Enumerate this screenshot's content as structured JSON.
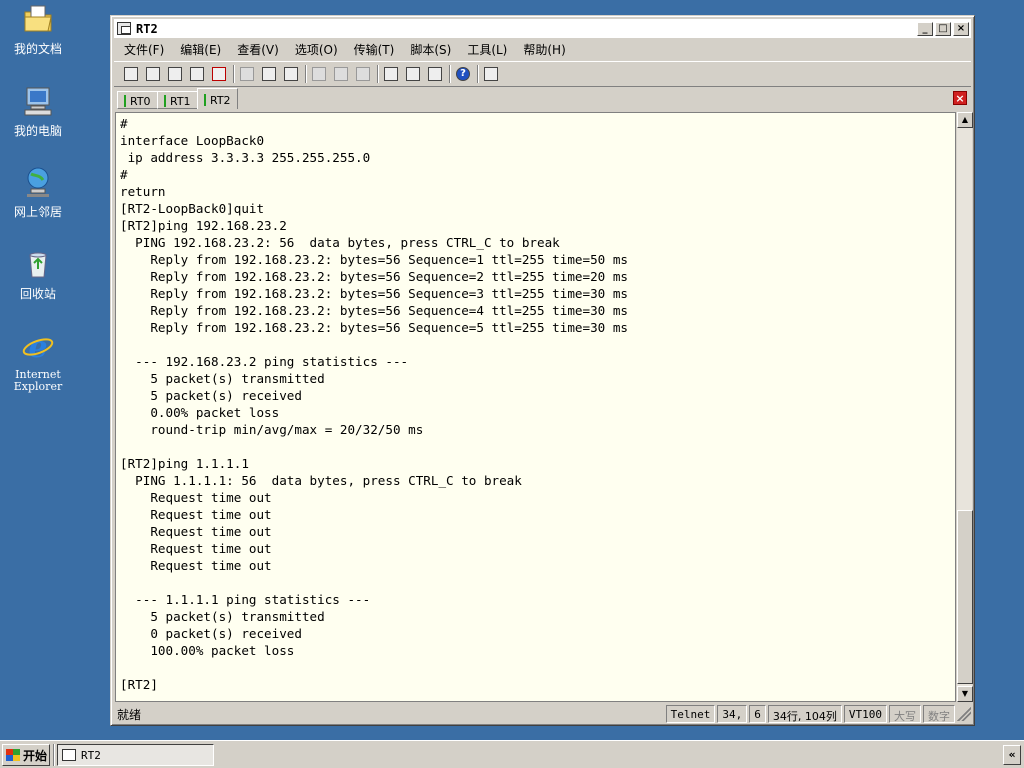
{
  "desktop": {
    "icons": [
      {
        "label": "我的文档",
        "icon": "folder-documents-icon"
      },
      {
        "label": "我的电脑",
        "icon": "computer-icon"
      },
      {
        "label": "网上邻居",
        "icon": "network-places-icon"
      },
      {
        "label": "回收站",
        "icon": "recycle-bin-icon"
      },
      {
        "label": "Internet\nExplorer",
        "icon": "internet-explorer-icon"
      }
    ]
  },
  "window": {
    "title": "RT2",
    "menu": [
      "文件(F)",
      "编辑(E)",
      "查看(V)",
      "选项(O)",
      "传输(T)",
      "脚本(S)",
      "工具(L)",
      "帮助(H)"
    ],
    "tabs": [
      "RT0",
      "RT1",
      "RT2"
    ],
    "active_tab": "RT2",
    "terminal_lines": [
      "#",
      "interface LoopBack0",
      " ip address 3.3.3.3 255.255.255.0",
      "#",
      "return",
      "[RT2-LoopBack0]quit",
      "[RT2]ping 192.168.23.2",
      "  PING 192.168.23.2: 56  data bytes, press CTRL_C to break",
      "    Reply from 192.168.23.2: bytes=56 Sequence=1 ttl=255 time=50 ms",
      "    Reply from 192.168.23.2: bytes=56 Sequence=2 ttl=255 time=20 ms",
      "    Reply from 192.168.23.2: bytes=56 Sequence=3 ttl=255 time=30 ms",
      "    Reply from 192.168.23.2: bytes=56 Sequence=4 ttl=255 time=30 ms",
      "    Reply from 192.168.23.2: bytes=56 Sequence=5 ttl=255 time=30 ms",
      "",
      "  --- 192.168.23.2 ping statistics ---",
      "    5 packet(s) transmitted",
      "    5 packet(s) received",
      "    0.00% packet loss",
      "    round-trip min/avg/max = 20/32/50 ms",
      "",
      "[RT2]ping 1.1.1.1",
      "  PING 1.1.1.1: 56  data bytes, press CTRL_C to break",
      "    Request time out",
      "    Request time out",
      "    Request time out",
      "    Request time out",
      "    Request time out",
      "",
      "  --- 1.1.1.1 ping statistics ---",
      "    5 packet(s) transmitted",
      "    0 packet(s) received",
      "    100.00% packet loss",
      "",
      "[RT2]"
    ],
    "status": {
      "ready": "就绪",
      "protocol": "Telnet",
      "cursor_row": "34,",
      "cursor_col": "6",
      "size": "34行, 104列",
      "emulation": "VT100",
      "caps": "大写",
      "num": "数字"
    }
  },
  "taskbar": {
    "start_label": "开始",
    "task_label": "RT2",
    "tray_chevron": "«"
  }
}
